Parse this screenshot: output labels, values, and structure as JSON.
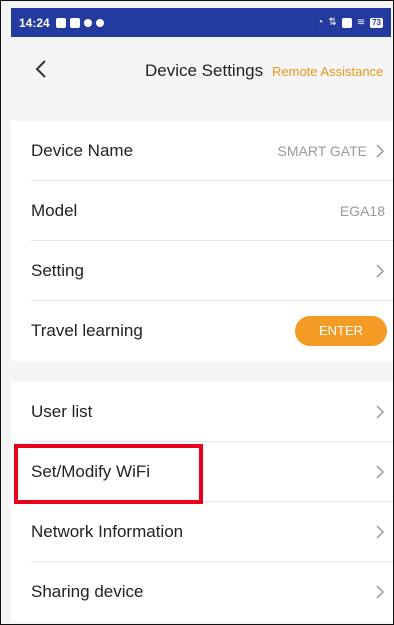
{
  "status_bar": {
    "time": "14:24",
    "battery": "73",
    "icons": [
      "tiktok-icon",
      "notification-icon",
      "settings-icon",
      "game-icon",
      "speed-icon",
      "data-icon",
      "sim-icon",
      "wifi-icon"
    ]
  },
  "header": {
    "back_icon": "chevron-left-icon",
    "title": "Device Settings",
    "action": "Remote Assistance",
    "action_color": "#e8961e"
  },
  "section1": {
    "rows": [
      {
        "label": "Device Name",
        "value": "SMART GATE"
      },
      {
        "label": "Model",
        "value": "EGA18"
      },
      {
        "label": "Setting"
      },
      {
        "label": "Travel learning",
        "button": "ENTER"
      }
    ]
  },
  "section2": {
    "rows": [
      {
        "label": "User list"
      },
      {
        "label": "Set/Modify WiFi"
      },
      {
        "label": "Network Information"
      },
      {
        "label": "Sharing device"
      }
    ]
  },
  "colors": {
    "accent": "#f39b24",
    "highlight": "#e8001c",
    "status_bar": "#233a9f"
  }
}
